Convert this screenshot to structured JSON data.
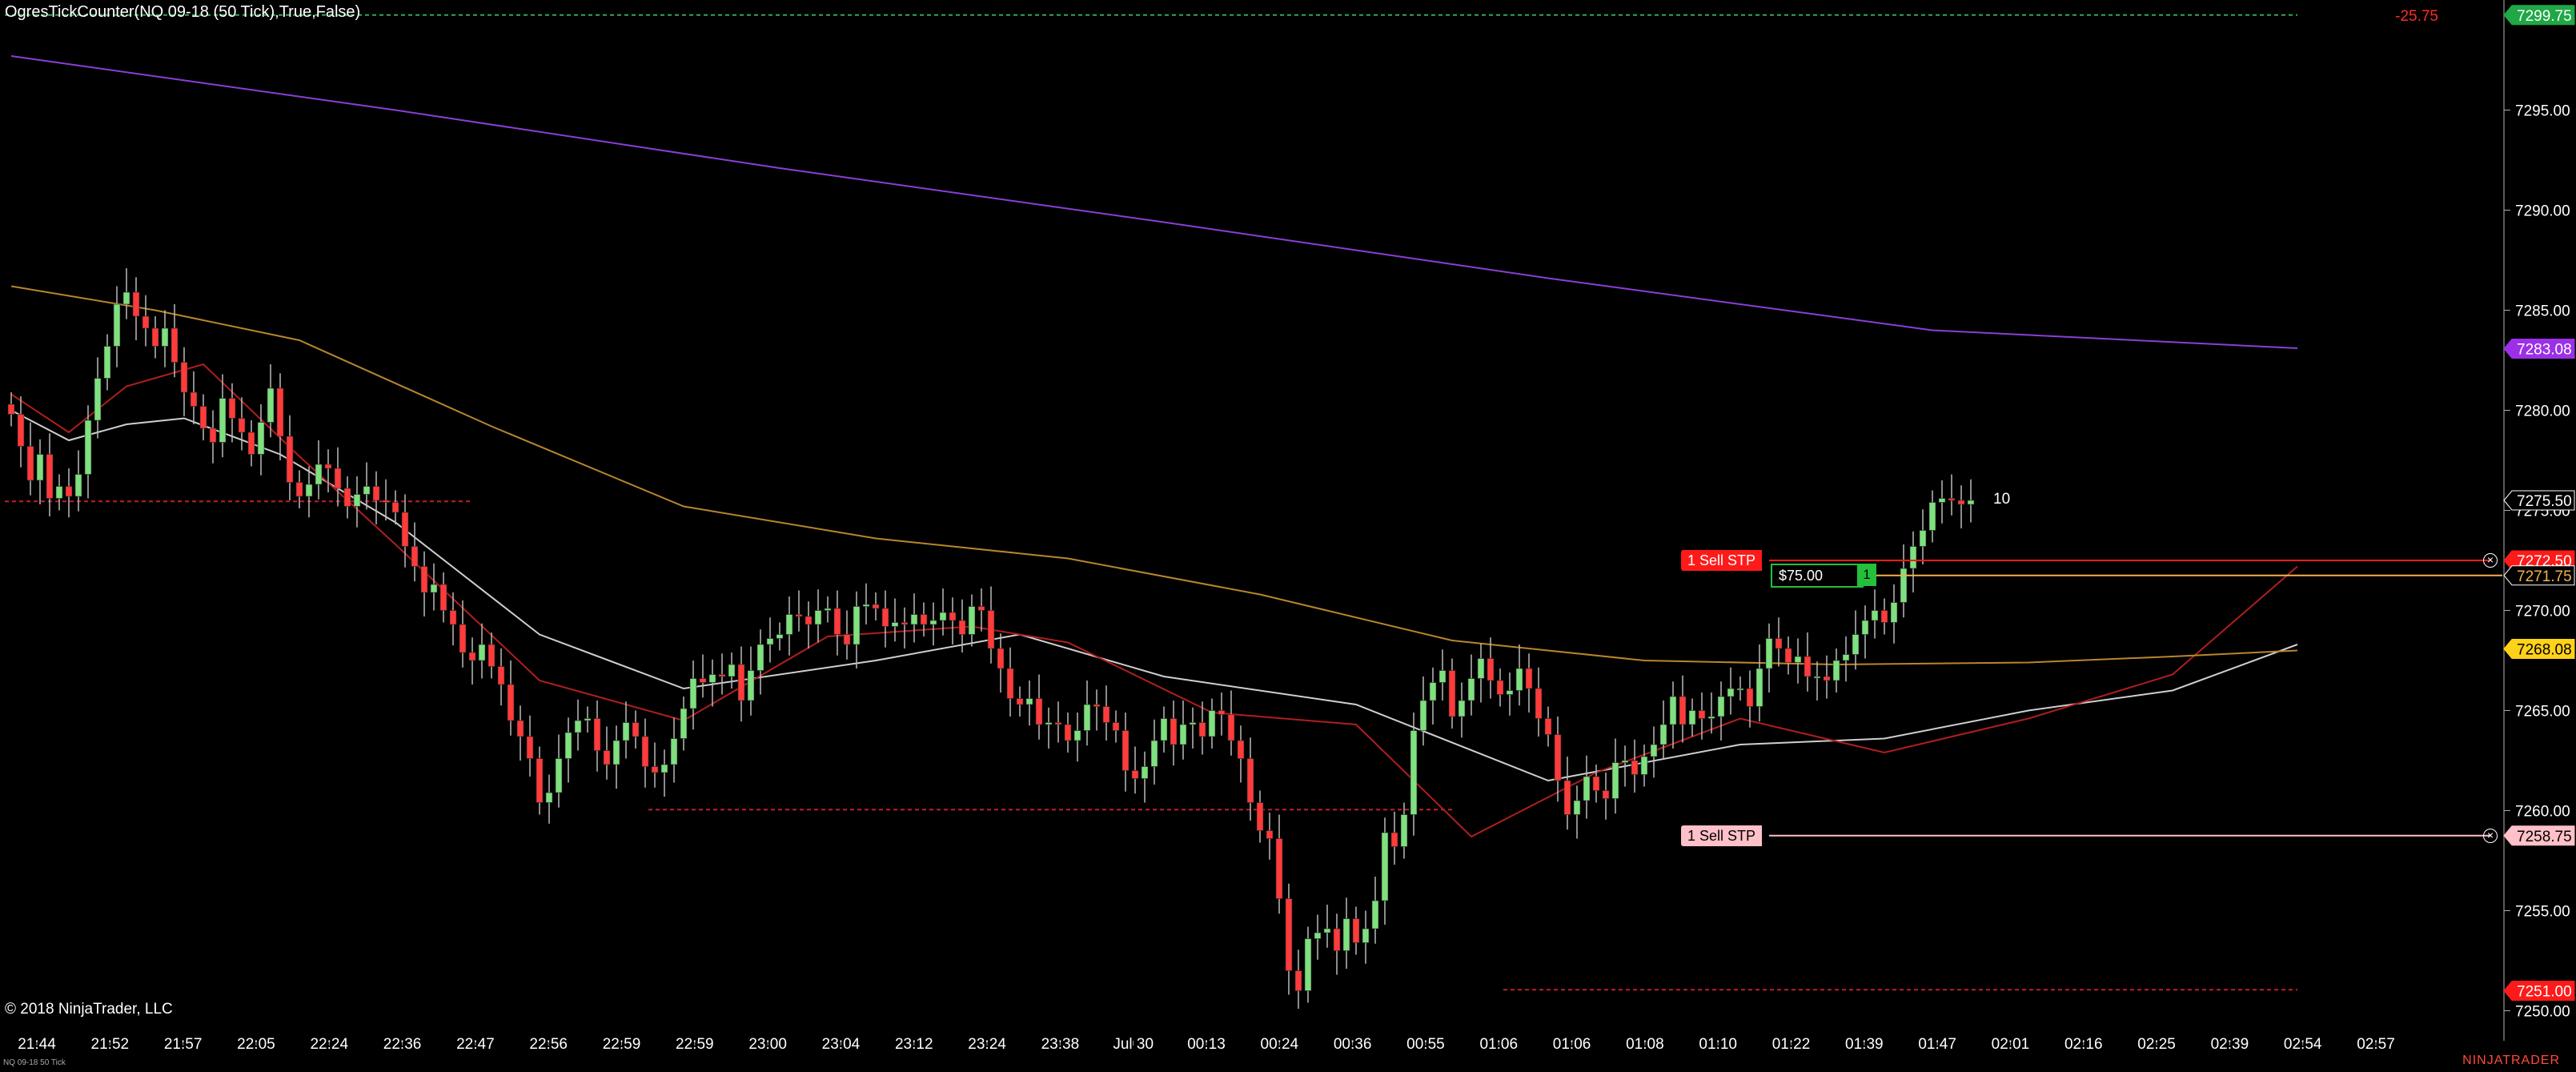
{
  "indicator_title": "OgresTickCounter(NQ 09-18 (50 Tick),True,False)",
  "tick_counter_value": "10",
  "copyright": "© 2018 NinjaTrader, LLC",
  "instrument_label": "NQ 09-18 50 Tick",
  "logo": "NINJATRADER",
  "position_pnl_top": "-25.75",
  "orders": [
    {
      "label": "1 Sell STP",
      "price": 7272.5,
      "tag_color": "#ff1a1a",
      "line_color": "#ff1a1a",
      "text_color": "#ffffff",
      "price_label": "7272.50",
      "close_icon": "close-icon"
    },
    {
      "label": "1 Sell STP",
      "price": 7258.75,
      "tag_color": "#ffc0c8",
      "line_color": "#ffc0c8",
      "text_color": "#000000",
      "price_label": "7258.75",
      "close_icon": "close-icon"
    }
  ],
  "position": {
    "pnl": "$75.00",
    "qty": "1",
    "entry_price": 7271.75,
    "entry_label": "7271.75",
    "line_color": "#f3b24c"
  },
  "price_markers": [
    {
      "value": 7299.75,
      "label": "7299.75",
      "bg": "#1fa845",
      "fg": "#ffffff"
    },
    {
      "value": 7283.08,
      "label": "7283.08",
      "bg": "#9b30e8",
      "fg": "#ffffff"
    },
    {
      "value": 7275.5,
      "label": "7275.50",
      "bg": "#000000",
      "fg": "#ffffff"
    },
    {
      "value": 7268.08,
      "label": "7268.08",
      "bg": "#ffd21a",
      "fg": "#000000"
    },
    {
      "value": 7251.0,
      "label": "7251.00",
      "bg": "#ff1a1a",
      "fg": "#ffffff"
    }
  ],
  "chart_data": {
    "type": "candlestick",
    "ylim": [
      7248.5,
      7300.5
    ],
    "y_ticks": [
      7250,
      7255,
      7260,
      7265,
      7270,
      7275,
      7280,
      7285,
      7290,
      7295
    ],
    "y_tick_labels": [
      "7250.00",
      "7255.00",
      "7260.00",
      "7265.00",
      "7270.00",
      "7275.00",
      "7280.00",
      "7285.00",
      "7290.00",
      "7295.00"
    ],
    "x_labels": [
      "21:44",
      "21:52",
      "21:57",
      "22:05",
      "22:24",
      "22:36",
      "22:47",
      "22:56",
      "22:59",
      "22:59",
      "23:00",
      "23:04",
      "23:12",
      "23:24",
      "23:38",
      "Jul 30",
      "00:13",
      "00:24",
      "00:36",
      "00:55",
      "01:06",
      "01:06",
      "01:08",
      "01:10",
      "01:22",
      "01:39",
      "01:47",
      "02:01",
      "02:16",
      "02:25",
      "02:39",
      "02:54",
      "02:57"
    ],
    "closes": [
      7279.8,
      7278.2,
      7276.5,
      7277.8,
      7275.6,
      7276.2,
      7275.7,
      7276.8,
      7279.5,
      7281.6,
      7283.2,
      7285.3,
      7285.9,
      7284.7,
      7284.1,
      7283.2,
      7284.1,
      7282.4,
      7280.9,
      7280.2,
      7279.1,
      7278.4,
      7280.6,
      7279.6,
      7278.9,
      7277.8,
      7279.4,
      7281.1,
      7278.7,
      7276.4,
      7275.7,
      7276.3,
      7277.3,
      7277.1,
      7276.1,
      7275.2,
      7275.8,
      7276.2,
      7275.5,
      7275.4,
      7274.9,
      7273.2,
      7272.2,
      7270.9,
      7271.3,
      7270.0,
      7269.3,
      7267.9,
      7267.5,
      7268.3,
      7267.2,
      7266.3,
      7264.5,
      7263.7,
      7262.6,
      7260.4,
      7260.9,
      7262.6,
      7263.9,
      7264.5,
      7264.6,
      7263.0,
      7262.3,
      7263.5,
      7264.4,
      7263.7,
      7262.2,
      7261.9,
      7262.3,
      7263.6,
      7265.1,
      7266.6,
      7266.4,
      7266.8,
      7266.7,
      7267.3,
      7265.5,
      7267.0,
      7268.3,
      7268.6,
      7268.8,
      7269.8,
      7269.7,
      7269.3,
      7270.0,
      7270.1,
      7268.8,
      7268.3,
      7270.2,
      7270.3,
      7270.1,
      7269.2,
      7269.4,
      7269.3,
      7269.8,
      7269.3,
      7269.5,
      7269.9,
      7269.5,
      7268.8,
      7270.2,
      7270.0,
      7268.1,
      7267.1,
      7265.6,
      7265.3,
      7265.6,
      7264.3,
      7264.4,
      7264.3,
      7263.5,
      7264.0,
      7265.3,
      7265.2,
      7264.4,
      7264.0,
      7262.0,
      7261.6,
      7262.2,
      7263.5,
      7264.6,
      7263.3,
      7264.3,
      7264.4,
      7263.7,
      7265.0,
      7264.8,
      7263.5,
      7262.6,
      7260.4,
      7259.0,
      7258.6,
      7255.6,
      7252.0,
      7251.0,
      7253.6,
      7253.9,
      7254.1,
      7253.0,
      7254.6,
      7253.4,
      7254.1,
      7255.5,
      7258.9,
      7258.2,
      7259.8,
      7264.0,
      7265.5,
      7266.4,
      7267.0,
      7264.7,
      7265.5,
      7266.6,
      7267.6,
      7266.5,
      7265.8,
      7266.0,
      7267.1,
      7266.1,
      7264.6,
      7263.8,
      7261.5,
      7259.8,
      7260.5,
      7261.7,
      7261.0,
      7260.6,
      7262.4,
      7262.5,
      7261.8,
      7262.7,
      7263.3,
      7264.3,
      7265.7,
      7264.3,
      7265.0,
      7264.6,
      7264.7,
      7265.7,
      7266.1,
      7266.1,
      7265.2,
      7267.1,
      7268.6,
      7268.1,
      7267.4,
      7267.7,
      7266.7,
      7266.7,
      7266.5,
      7267.5,
      7267.8,
      7268.8,
      7269.5,
      7270.0,
      7269.4,
      7270.4,
      7272.1,
      7273.2,
      7274.0,
      7275.4,
      7275.6,
      7275.5,
      7275.3,
      7275.5
    ],
    "series": [
      {
        "name": "SMA (white)",
        "color": "#cfcfcf",
        "x": [
          0,
          6,
          12,
          18,
          28,
          40,
          55,
          70,
          90,
          105,
          120,
          140,
          160,
          180,
          195,
          210,
          225,
          238
        ],
        "values": [
          7280.0,
          7278.5,
          7279.3,
          7279.6,
          7277.8,
          7274.4,
          7268.8,
          7266.1,
          7267.5,
          7268.8,
          7266.7,
          7265.3,
          7261.5,
          7263.3,
          7263.6,
          7265.0,
          7266.0,
          7268.3
        ]
      },
      {
        "name": "EMA (red)",
        "color": "#b01e1e",
        "x": [
          0,
          6,
          12,
          20,
          30,
          40,
          55,
          70,
          85,
          100,
          110,
          125,
          140,
          152,
          165,
          180,
          195,
          210,
          225,
          238
        ],
        "values": [
          7280.8,
          7278.9,
          7281.2,
          7282.3,
          7277.7,
          7273.3,
          7266.5,
          7264.5,
          7268.7,
          7269.2,
          7268.4,
          7264.9,
          7264.3,
          7258.7,
          7261.9,
          7264.6,
          7262.9,
          7264.6,
          7266.8,
          7272.2
        ]
      },
      {
        "name": "Long MA (gold)",
        "color": "#b8862c",
        "x": [
          0,
          15,
          30,
          50,
          70,
          90,
          110,
          130,
          150,
          170,
          190,
          210,
          225,
          238
        ],
        "values": [
          7286.2,
          7285.0,
          7283.5,
          7279.2,
          7275.2,
          7273.6,
          7272.6,
          7270.8,
          7268.5,
          7267.5,
          7267.3,
          7267.4,
          7267.7,
          7268.0
        ]
      },
      {
        "name": "Very long MA (purple)",
        "color": "#8a3fd6",
        "x": [
          0,
          40,
          80,
          120,
          160,
          200,
          238
        ],
        "values": [
          7297.7,
          7295.0,
          7292.1,
          7289.4,
          7286.6,
          7284.0,
          7283.1
        ]
      }
    ],
    "horizontal_lines": [
      {
        "value": 7299.75,
        "color": "#2ea85a",
        "dash": true,
        "x0": 0,
        "x1": 238
      },
      {
        "value": 7275.45,
        "color": "#c0202a",
        "dash": true,
        "x0": 0,
        "x1": 48
      },
      {
        "value": 7260.05,
        "color": "#c0202a",
        "dash": true,
        "x0": 67,
        "x1": 150
      },
      {
        "value": 7251.05,
        "color": "#c0202a",
        "dash": true,
        "x0": 156,
        "x1": 238
      }
    ]
  }
}
